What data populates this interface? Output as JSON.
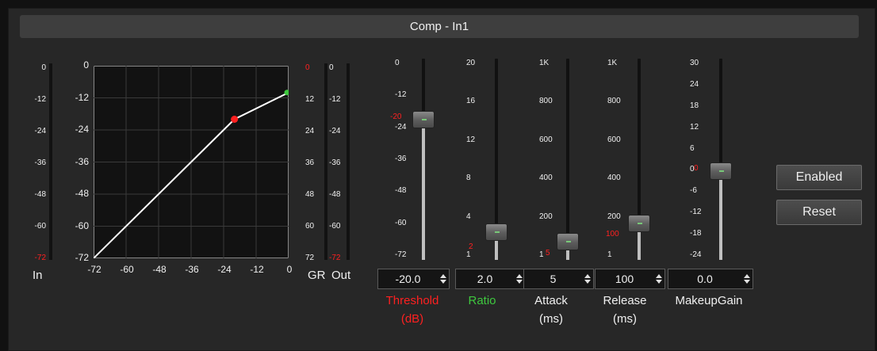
{
  "title": "Comp - In1",
  "meters": {
    "in": {
      "label": "In",
      "ticks": [
        "0",
        "-12",
        "-24",
        "-36",
        "-48",
        "-60",
        "-72"
      ]
    },
    "gr": {
      "label": "GR",
      "ticks": [
        "0",
        "12",
        "24",
        "36",
        "48",
        "60",
        "72"
      ]
    },
    "out": {
      "label": "Out",
      "ticks": [
        "0",
        "-12",
        "-24",
        "-36",
        "-48",
        "-60",
        "-72"
      ]
    }
  },
  "graph": {
    "y_ticks": [
      "0",
      "-12",
      "-24",
      "-36",
      "-48",
      "-60",
      "-72"
    ],
    "x_ticks": [
      "-72",
      "-60",
      "-48",
      "-36",
      "-24",
      "-12",
      "0"
    ],
    "curve_color": "#ffffff",
    "threshold_point_color": "#ff2020",
    "end_point_color": "#3ec83e"
  },
  "sliders": {
    "threshold": {
      "ticks": [
        "0",
        "-12",
        "-24",
        "-36",
        "-48",
        "-60",
        "-72"
      ],
      "marker": "-20",
      "value": "-20.0",
      "label_line1": "Threshold",
      "label_line2": "(dB)",
      "level": 0.72
    },
    "ratio": {
      "ticks": [
        "20",
        "16",
        "12",
        "8",
        "4",
        "1"
      ],
      "marker": "2",
      "value": "2.0",
      "label_line1": "Ratio",
      "level": 0.11
    },
    "attack": {
      "ticks": [
        "1K",
        "800",
        "600",
        "400",
        "200",
        "1"
      ],
      "marker": "5",
      "value": "5",
      "label_line1": "Attack",
      "label_line2": "(ms)",
      "level": 0.06
    },
    "release": {
      "ticks": [
        "1K",
        "800",
        "600",
        "400",
        "200",
        "1"
      ],
      "marker": "100",
      "value": "100",
      "label_line1": "Release",
      "label_line2": "(ms)",
      "level": 0.16
    },
    "makeup": {
      "ticks": [
        "30",
        "24",
        "18",
        "12",
        "6",
        "0",
        "-6",
        "-12",
        "-18",
        "-24"
      ],
      "marker": "0",
      "value": "0.0",
      "label_line1": "MakeupGain",
      "level": 0.44
    }
  },
  "buttons": {
    "enabled": "Enabled",
    "reset": "Reset"
  }
}
